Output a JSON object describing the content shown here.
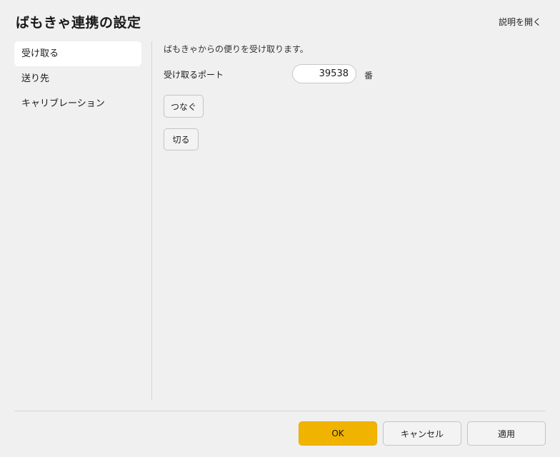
{
  "dialog": {
    "title": "ばもきゃ連携の設定",
    "help_link": "説明を開く"
  },
  "sidebar": {
    "items": [
      {
        "label": "受け取る",
        "active": true
      },
      {
        "label": "送り先",
        "active": false
      },
      {
        "label": "キャリブレーション",
        "active": false
      }
    ]
  },
  "receive": {
    "description": "ばもきゃからの便りを受け取ります。",
    "port_label": "受け取るポート",
    "port_value": "39538",
    "port_unit": "番",
    "connect_label": "つなぐ",
    "disconnect_label": "切る"
  },
  "footer": {
    "ok_label": "OK",
    "cancel_label": "キャンセル",
    "apply_label": "適用"
  },
  "colors": {
    "primary_button": "#f0b400",
    "background": "#f0f0f0",
    "active_item": "#ffffff"
  }
}
